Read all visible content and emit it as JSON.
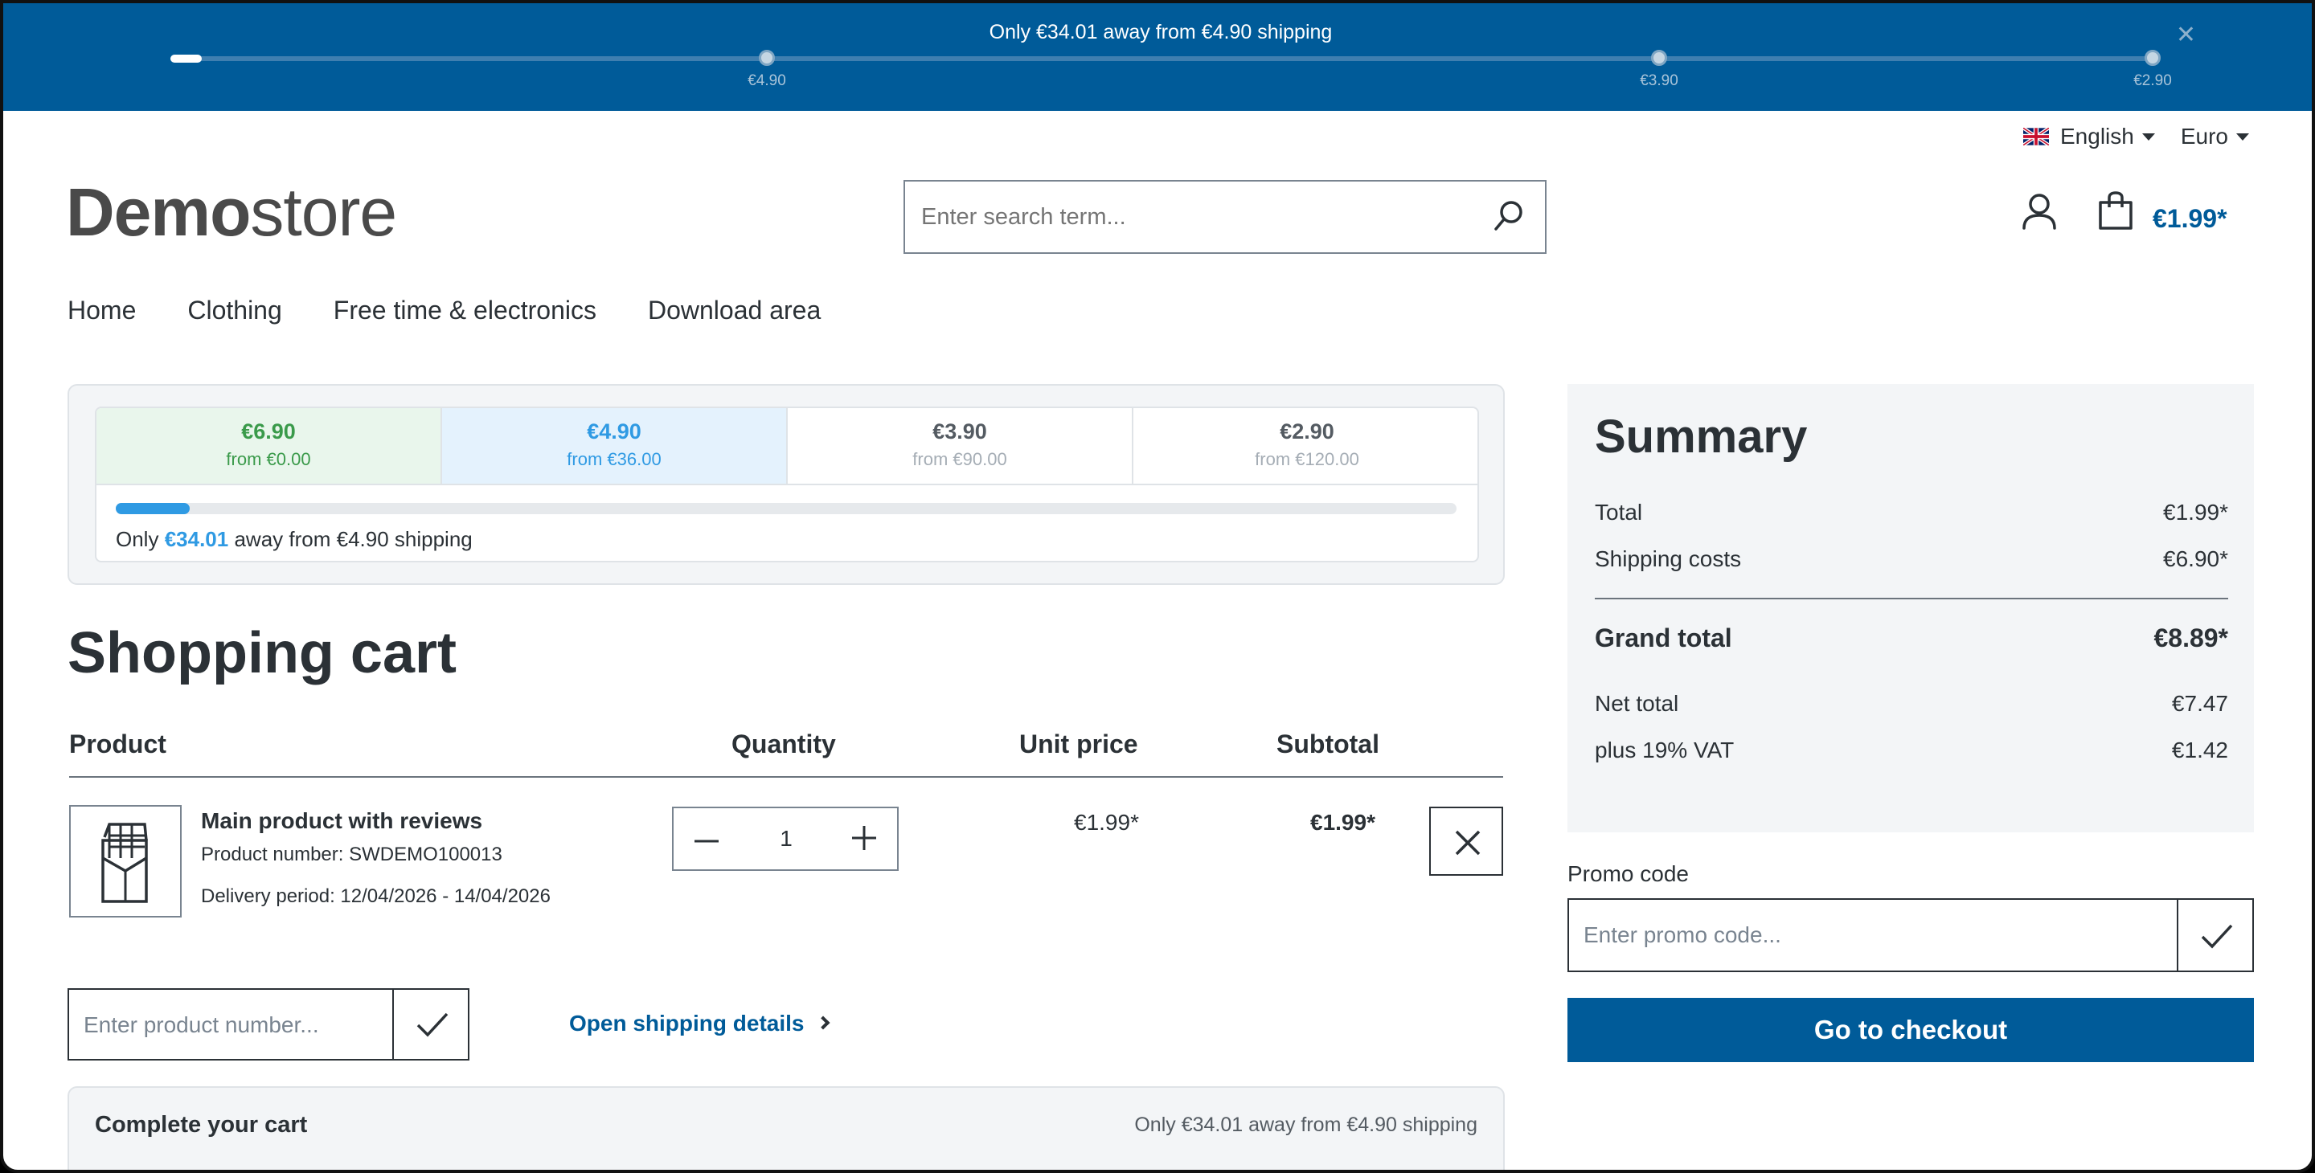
{
  "banner": {
    "message": "Only €34.01 away from €4.90 shipping",
    "progress_percent": 1.4,
    "milestones": [
      "€4.90",
      "€3.90",
      "€2.90"
    ]
  },
  "topbar": {
    "language": "English",
    "currency": "Euro"
  },
  "logo": {
    "bold": "Demo",
    "light": "store"
  },
  "search": {
    "placeholder": "Enter search term..."
  },
  "header": {
    "cart_total": "€1.99*"
  },
  "nav": [
    "Home",
    "Clothing",
    "Free time & electronics",
    "Download area"
  ],
  "shipping_tiers": {
    "tiers": [
      {
        "price": "€6.90",
        "from": "from €0.00"
      },
      {
        "price": "€4.90",
        "from": "from €36.00"
      },
      {
        "price": "€3.90",
        "from": "from €90.00"
      },
      {
        "price": "€2.90",
        "from": "from €120.00"
      }
    ],
    "progress_percent": 5.5,
    "message_prefix": "Only",
    "message_amount": "€34.01",
    "message_suffix": "away from €4.90 shipping"
  },
  "page_title": "Shopping cart",
  "table": {
    "headers": {
      "product": "Product",
      "quantity": "Quantity",
      "unit_price": "Unit price",
      "subtotal": "Subtotal"
    },
    "item": {
      "name": "Main product with reviews",
      "number": "Product number: SWDEMO100013",
      "delivery": "Delivery period: 12/04/2026 - 14/04/2026",
      "quantity": "1",
      "unit_price": "€1.99*",
      "subtotal": "€1.99*"
    }
  },
  "product_number": {
    "placeholder": "Enter product number..."
  },
  "shipping_link": "Open shipping details",
  "complete_cart": {
    "title": "Complete your cart",
    "message": "Only €34.01 away from €4.90 shipping"
  },
  "summary": {
    "title": "Summary",
    "total_label": "Total",
    "total_value": "€1.99*",
    "shipping_label": "Shipping costs",
    "shipping_value": "€6.90*",
    "grand_label": "Grand total",
    "grand_value": "€8.89*",
    "net_label": "Net total",
    "net_value": "€7.47",
    "vat_label": "plus 19% VAT",
    "vat_value": "€1.42"
  },
  "promo": {
    "label": "Promo code",
    "placeholder": "Enter promo code..."
  },
  "checkout_label": "Go to checkout",
  "colors": {
    "brand": "#005b99",
    "accent": "#2f9ae3",
    "success": "#3a9a4a"
  }
}
